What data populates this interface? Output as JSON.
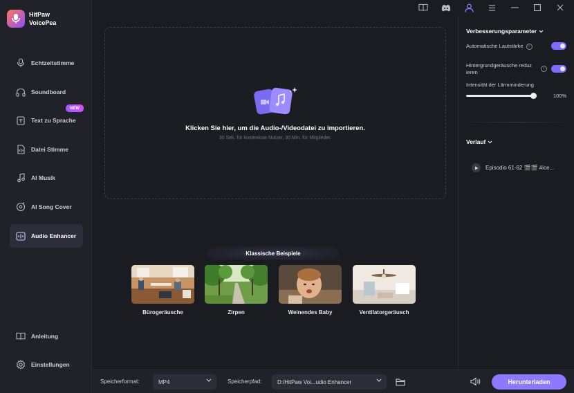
{
  "app": {
    "name_line1": "HitPaw",
    "name_line2": "VoicePea"
  },
  "sidebar": {
    "items": [
      {
        "label": "Echtzeitstimme",
        "icon": "microphone-icon"
      },
      {
        "label": "Soundboard",
        "icon": "headphones-icon"
      },
      {
        "label": "Text zu Sprache",
        "icon": "text-to-speech-icon",
        "badge": "NEW"
      },
      {
        "label": "Datei Stimme",
        "icon": "file-voice-icon"
      },
      {
        "label": "AI Musik",
        "icon": "music-note-icon"
      },
      {
        "label": "AI Song Cover",
        "icon": "song-cover-icon"
      },
      {
        "label": "Audio Enhancer",
        "icon": "audio-enhancer-icon",
        "active": true
      }
    ],
    "bottom_items": [
      {
        "label": "Anleitung",
        "icon": "book-icon"
      },
      {
        "label": "Einstellungen",
        "icon": "gear-icon"
      }
    ]
  },
  "topbar": {
    "icons": [
      "guide-book-icon",
      "discord-icon",
      "user-icon",
      "menu-icon",
      "minimize-icon",
      "maximize-icon",
      "close-icon"
    ]
  },
  "dropzone": {
    "title": "Klicken Sie hier, um die Audio-/Videodatei zu importieren.",
    "subtitle": "30 Sek. für kostenlose Nutzer, 30 Min. für Mitglieder."
  },
  "examples": {
    "header": "Klassische Beispiele",
    "items": [
      {
        "label": "Bürogeräusche"
      },
      {
        "label": "Zirpen"
      },
      {
        "label": "Weinendes Baby"
      },
      {
        "label": "Ventilatorgeräusch"
      }
    ]
  },
  "right_panel": {
    "params_title": "Verbesserungsparameter",
    "auto_volume_label": "Automatische Lautstärke",
    "noise_reduce_label_line1": "Hintergrundgeräusche reduz",
    "noise_reduce_label_line2": "ieren",
    "noise_intensity_label": "Intensität der Lärmminderung",
    "noise_intensity_value": "100%",
    "noise_intensity_fraction": 1.0,
    "history_title": "Verlauf",
    "history_items": [
      {
        "label": "Episodio 61-62 🎬🎬 #ice..."
      }
    ]
  },
  "bottombar": {
    "format_label": "Speicherformat:",
    "format_value": "MP4",
    "path_label": "Speicherpfad:",
    "path_value": "D:/HitPaw Voi...udio Enhancer",
    "download_label": "Herunterladen"
  },
  "colors": {
    "accent": "#8c79ff",
    "toggle_on": "#7f6cff",
    "background": "#1b1b22",
    "sidebar": "#212129"
  }
}
